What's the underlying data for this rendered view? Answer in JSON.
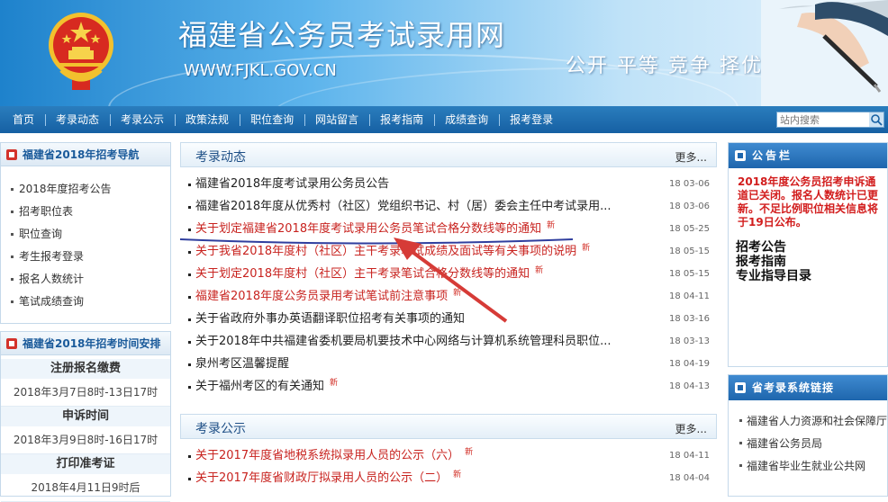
{
  "header": {
    "title": "福建省公务员考试录用网",
    "url": "WWW.FJKL.GOV.CN",
    "slogan": "公开 平等 竞争 择优"
  },
  "nav": {
    "items": [
      "首页",
      "考录动态",
      "考录公示",
      "政策法规",
      "职位查询",
      "网站留言",
      "报考指南",
      "成绩查询",
      "报考登录"
    ],
    "search_placeholder": "站内搜索"
  },
  "left": {
    "guide": {
      "title": "福建省2018年招考导航",
      "items": [
        "2018年度招考公告",
        "招考职位表",
        "职位查询",
        "考生报考登录",
        "报名人数统计",
        "笔试成绩查询"
      ]
    },
    "timeline": {
      "title": "福建省2018年招考时间安排",
      "items": [
        {
          "title": "注册报名缴费",
          "date": "2018年3月7日8时-13日17时"
        },
        {
          "title": "申诉时间",
          "date": "2018年3月9日8时-16日17时"
        },
        {
          "title": "打印准考证",
          "date": "2018年4月11日9时后"
        }
      ]
    }
  },
  "main": {
    "news": {
      "title": "考录动态",
      "more": "更多...",
      "items": [
        {
          "text": "福建省2018年度考试录用公务员公告",
          "date": "18 03-06",
          "red": false,
          "new": ""
        },
        {
          "text": "福建省2018年度从优秀村（社区）党组织书记、村（居）委会主任中考试录用...",
          "date": "18 03-06",
          "red": false,
          "new": ""
        },
        {
          "text": "关于划定福建省2018年度考试录用公务员笔试合格分数线等的通知",
          "date": "18 05-25",
          "red": true,
          "new": "新"
        },
        {
          "text": "关于我省2018年度村（社区）主干考录笔试成绩及面试等有关事项的说明",
          "date": "18 05-15",
          "red": true,
          "new": "新"
        },
        {
          "text": "关于划定2018年度村（社区）主干考录笔试合格分数线等的通知",
          "date": "18 05-15",
          "red": true,
          "new": "新"
        },
        {
          "text": "福建省2018年度公务员录用考试笔试前注意事项",
          "date": "18 04-11",
          "red": true,
          "new": "新"
        },
        {
          "text": "关于省政府外事办英语翻译职位招考有关事项的通知",
          "date": "18 03-16",
          "red": false,
          "new": ""
        },
        {
          "text": "关于2018年中共福建省委机要局机要技术中心网络与计算机系统管理科员职位...",
          "date": "18 03-13",
          "red": false,
          "new": ""
        },
        {
          "text": "泉州考区温馨提醒",
          "date": "18 04-19",
          "red": false,
          "new": ""
        },
        {
          "text": "关于福州考区的有关通知",
          "date": "18 04-13",
          "red": false,
          "new": "新"
        }
      ]
    },
    "publicity": {
      "title": "考录公示",
      "more": "更多...",
      "items": [
        {
          "text": "关于2017年度省地税系统拟录用人员的公示（六）",
          "date": "18 04-11",
          "red": true,
          "new": "新"
        },
        {
          "text": "关于2017年度省财政厅拟录用人员的公示（二）",
          "date": "18 04-04",
          "red": true,
          "new": "新"
        }
      ]
    }
  },
  "right": {
    "board": {
      "title": "公告栏",
      "notice": "2018年度公务员招考申诉通道已关闭。报名人数统计已更新。不足比例职位相关信息将于19日公布。",
      "links": [
        "招考公告",
        "报考指南",
        "专业指导目录"
      ]
    },
    "system": {
      "title": "省考录系统链接",
      "items": [
        "福建省人力资源和社会保障厅",
        "福建省公务员局",
        "福建省毕业生就业公共网"
      ]
    }
  },
  "colors": {
    "nav": "#1660a3",
    "accent_red": "#c8231f",
    "annotation": "#d63b37",
    "underline": "#2f3e9e"
  }
}
